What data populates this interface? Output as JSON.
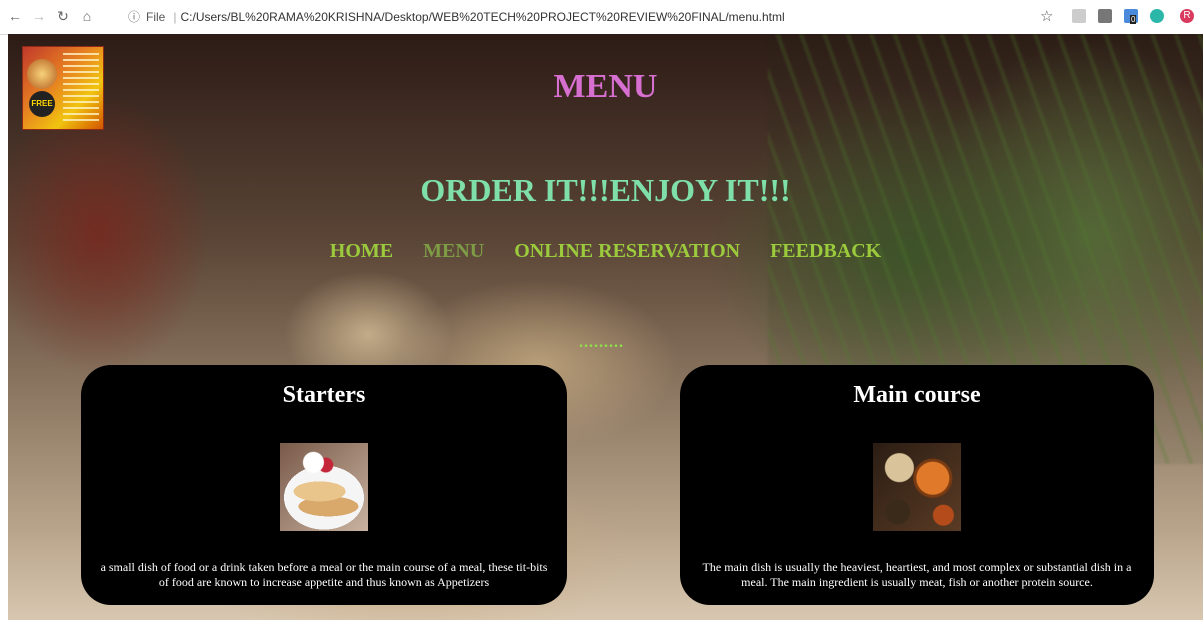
{
  "browser": {
    "file_label": "File",
    "url": "C:/Users/BL%20RAMA%20KRISHNA/Desktop/WEB%20TECH%20PROJECT%20REVIEW%20FINAL/menu.html",
    "extension_badge": "0",
    "profile_initial": "R"
  },
  "header": {
    "title": "MENU",
    "tagline": "ORDER IT!!!ENJOY IT!!!"
  },
  "nav": {
    "home": "HOME",
    "menu": "MENU",
    "reservation": "ONLINE RESERVATION",
    "feedback": "FEEDBACK"
  },
  "decor_dots": ".........",
  "cards": {
    "starters": {
      "title": "Starters",
      "description": "a small dish of food or a drink taken before a meal or the main course of a meal, these tit-bits of food are known to increase appetite and thus known as Appetizers"
    },
    "main": {
      "title": "Main course",
      "description": "The main dish is usually the heaviest, heartiest, and most complex or substantial dish in a meal. The main ingredient is usually meat, fish or another protein source."
    }
  },
  "colors": {
    "title": "#d66fd0",
    "tagline": "#7ee0a8",
    "nav": "#9bcb3c",
    "card_bg": "#000000"
  }
}
